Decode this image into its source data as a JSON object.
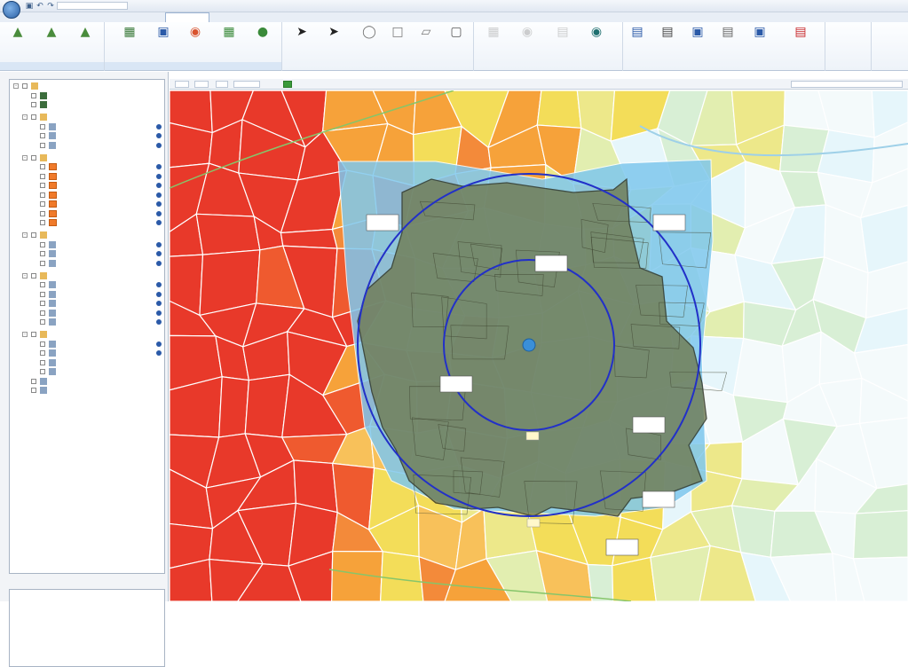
{
  "colors": {
    "accent": "#1f4fc4",
    "ring": "#2230c8",
    "trade_area": "#707c55",
    "center_point": "#3a8fd8",
    "choropleth_high": "#e8392a",
    "choropleth_mid": "#f6a23a",
    "choropleth_low": "#f3dd59",
    "choropleth_min": "#e6f6fb",
    "outside_water": "#7fc8ee"
  },
  "icons": {
    "app": "globe-icon",
    "save": "save-icon",
    "undo": "undo-icon",
    "redo": "redo-icon",
    "pointer": "arrow-pointer-icon",
    "circle": "circle-tool-icon",
    "rect": "rectangle-tool-icon",
    "eye": "eye-icon",
    "print": "print-icon",
    "pdf": "pdf-icon"
  },
  "ribbon": {
    "buttons": [
      "",
      "",
      "",
      "",
      "",
      "",
      "",
      "",
      "",
      "",
      "",
      "",
      "",
      "",
      "",
      "",
      "",
      "",
      "",
      "",
      "",
      "",
      "",
      "",
      ""
    ],
    "group_labels": [
      "",
      "",
      "",
      "",
      "",
      ""
    ],
    "mini_buttons": [
      "",
      "",
      ""
    ]
  },
  "layer_tree": {
    "rows": [
      "",
      "",
      "",
      "",
      "",
      "",
      "",
      "",
      "",
      "",
      "",
      "",
      "",
      "",
      "",
      "",
      "",
      "",
      "",
      "",
      "",
      "",
      "",
      "",
      "",
      "",
      "",
      "",
      "",
      "",
      "",
      "",
      "",
      "",
      "",
      "",
      ""
    ]
  },
  "map_labels": {
    "road_markers": [
      "",
      ""
    ]
  }
}
